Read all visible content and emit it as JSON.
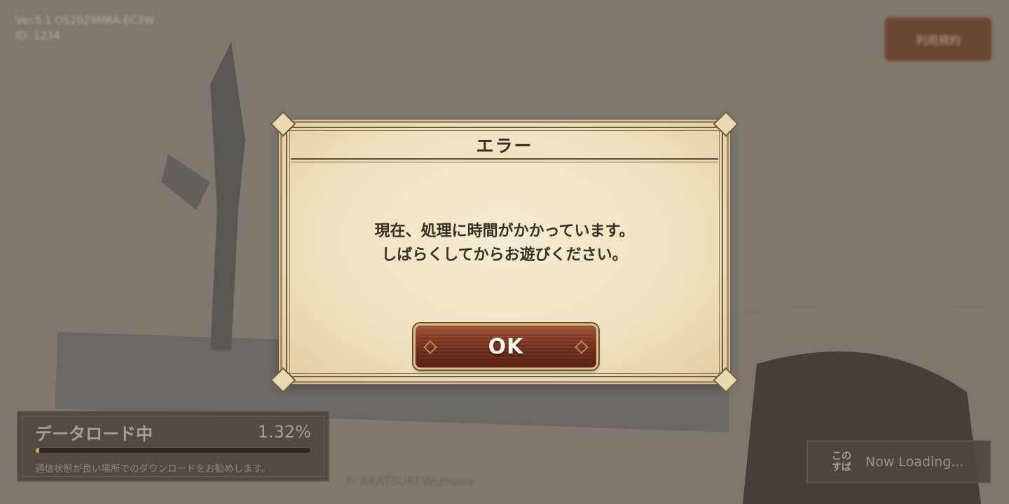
{
  "background": {
    "top_left_lines": [
      "Ver.5.1 OS2029MRA-EC3W",
      "ID: 1234"
    ],
    "top_right_button_label": "利用規約",
    "bottom_caption": "© AKATSUKI   Wumpus"
  },
  "load_panel": {
    "title": "データロード中",
    "percent_text": "1.32%",
    "progress_fraction": 0.0132,
    "hint": "通信状態が良い場所でのダウンロードをお勧めします。"
  },
  "now_loading": {
    "logo_text": "この すば",
    "label": "Now Loading..."
  },
  "dialog": {
    "title": "エラー",
    "message_lines": [
      "現在、処理に時間がかかっています。",
      "しばらくしてからお遊びください。"
    ],
    "ok_label": "OK"
  },
  "colors": {
    "parchment": "#f2e6c7",
    "frame_dark": "#6e5a3c",
    "button_red": "#7a321f",
    "button_text": "#fbf6ec",
    "text_dark": "#3a2f24"
  }
}
